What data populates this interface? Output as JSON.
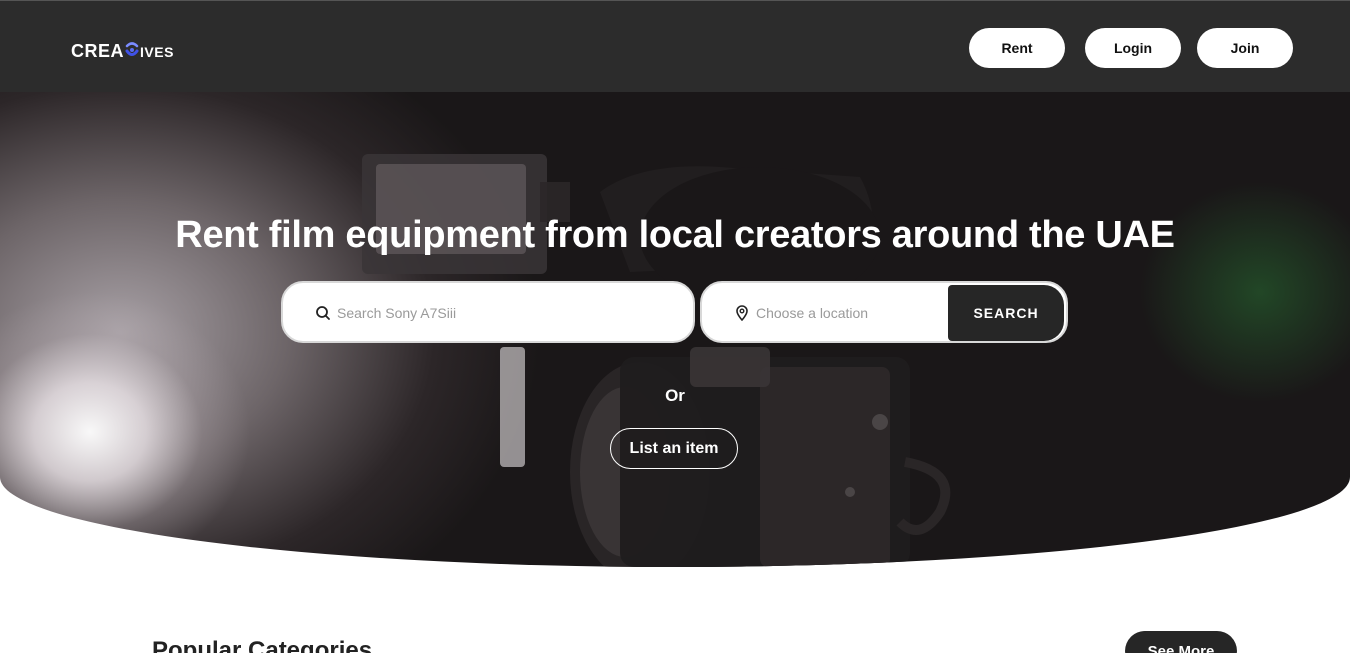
{
  "header": {
    "logo_text_start": "Crea",
    "logo_text_end": "ives",
    "nav": {
      "rent_label": "Rent",
      "login_label": "Login",
      "join_label": "Join"
    }
  },
  "hero": {
    "title": "Rent film equipment from local creators around the UAE",
    "search": {
      "placeholder": "Search Sony A7Siii",
      "value": ""
    },
    "location": {
      "placeholder": "Choose a location",
      "value": ""
    },
    "search_button_label": "SEARCH",
    "or_label": "Or",
    "list_item_label": "List an item"
  },
  "categories": {
    "title": "Popular Categories",
    "see_more_label": "See More"
  },
  "icons": {
    "search": "search-icon",
    "location": "map-pin-icon",
    "logo_mark": "swirl-icon"
  },
  "colors": {
    "navbar_bg": "#2c2c2c",
    "button_dark": "#262626",
    "logo_accent": "#5a6cf0"
  }
}
